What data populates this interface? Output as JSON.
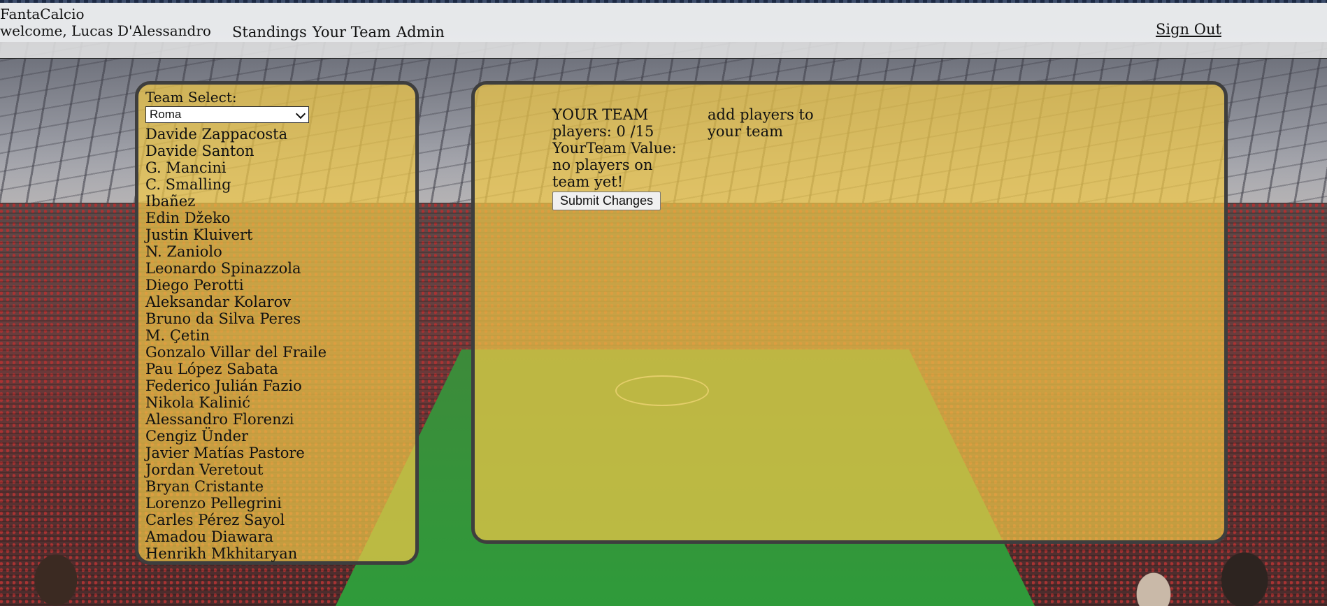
{
  "header": {
    "app_name": "FantaCalcio",
    "welcome": "welcome, Lucas D'Alessandro",
    "nav": [
      "Standings",
      "Your Team",
      "Admin"
    ],
    "sign_out": "Sign Out"
  },
  "team_panel": {
    "label": "Team Select:",
    "selected_team": "Roma",
    "players": [
      "Davide Zappacosta",
      "Davide Santon",
      "G. Mancini",
      "C. Smalling",
      "Ibañez",
      "Edin Džeko",
      "Justin Kluivert",
      "N. Zaniolo",
      "Leonardo Spinazzola",
      "Diego Perotti",
      "Aleksandar Kolarov",
      "Bruno da Silva Peres",
      "M. Çetin",
      "Gonzalo Villar del Fraile",
      "Pau López Sabata",
      "Federico Julián Fazio",
      "Nikola Kalinić",
      "Alessandro Florenzi",
      "Cengiz Ünder",
      "Javier Matías Pastore",
      "Jordan Veretout",
      "Bryan Cristante",
      "Lorenzo Pellegrini",
      "Carles Pérez Sayol",
      "Amadou Diawara",
      "Henrikh Mkhitaryan"
    ]
  },
  "your_team_panel": {
    "title": "YOUR TEAM",
    "players_count": "players: 0 /15",
    "value_label": "YourTeam Value:",
    "empty_message": "no players on team yet!",
    "submit_label": "Submit Changes",
    "hint": "add players to your team"
  }
}
